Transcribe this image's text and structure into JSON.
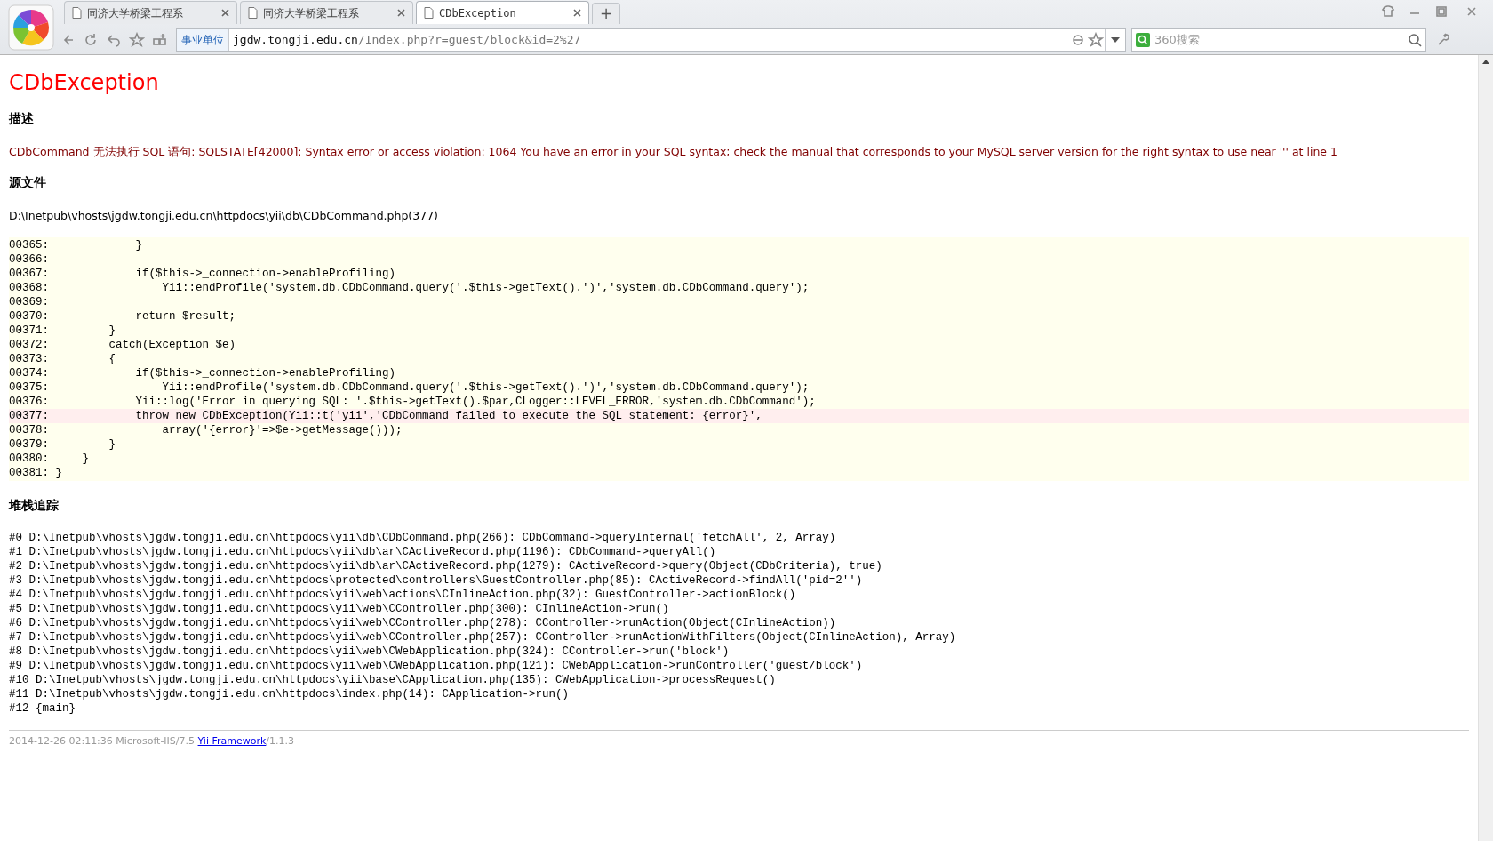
{
  "browser": {
    "tabs": [
      {
        "title": "同济大学桥梁工程系",
        "selected": false
      },
      {
        "title": "同济大学桥梁工程系",
        "selected": false
      },
      {
        "title": "CDbException",
        "selected": true
      }
    ],
    "new_tab": "+",
    "address_badge": "事业单位",
    "url_host": "jgdw.tongji.edu.cn",
    "url_path": "/Index.php?r=guest/block&id=2%27",
    "search_placeholder": "360搜索"
  },
  "page": {
    "title": "CDbException",
    "description_heading": "描述",
    "description": "CDbCommand 无法执行 SQL 语句: SQLSTATE[42000]: Syntax error or access violation: 1064 You have an error in your SQL syntax; check the manual that corresponds to your MySQL server version for the right syntax to use near ''' at line 1",
    "source_heading": "源文件",
    "source_file": "D:\\Inetpub\\vhosts\\jgdw.tongji.edu.cn\\httpdocs\\yii\\db\\CDbCommand.php(377)",
    "code_lines": [
      {
        "number": "00365:",
        "code": "            }",
        "highlighted": false
      },
      {
        "number": "00366:",
        "highlighted": false
      },
      {
        "number": "00367:",
        "code": "            if($this->_connection->enableProfiling)",
        "highlighted": false
      },
      {
        "number": "00368:",
        "code": "                Yii::endProfile('system.db.CDbCommand.query('.$this->getText().')','system.db.CDbCommand.query');",
        "highlighted": false
      },
      {
        "number": "00369:",
        "highlighted": false
      },
      {
        "number": "00370:",
        "code": "            return $result;",
        "highlighted": false
      },
      {
        "number": "00371:",
        "code": "        }",
        "highlighted": false
      },
      {
        "number": "00372:",
        "code": "        catch(Exception $e)",
        "highlighted": false
      },
      {
        "number": "00373:",
        "code": "        {",
        "highlighted": false
      },
      {
        "number": "00374:",
        "code": "            if($this->_connection->enableProfiling)",
        "highlighted": false
      },
      {
        "number": "00375:",
        "code": "                Yii::endProfile('system.db.CDbCommand.query('.$this->getText().')','system.db.CDbCommand.query');",
        "highlighted": false
      },
      {
        "number": "00376:",
        "code": "            Yii::log('Error in querying SQL: '.$this->getText().$par,CLogger::LEVEL_ERROR,'system.db.CDbCommand');",
        "highlighted": false
      },
      {
        "number": "00377:",
        "code": "            throw new CDbException(Yii::t('yii','CDbCommand failed to execute the SQL statement: {error}',",
        "highlighted": true
      },
      {
        "number": "00378:",
        "code": "                array('{error}'=>$e->getMessage()));",
        "highlighted": false
      },
      {
        "number": "00379:",
        "code": "        }",
        "highlighted": false
      },
      {
        "number": "00380:",
        "code": "    }",
        "highlighted": false
      },
      {
        "number": "00381:",
        "code": "}",
        "highlighted": false
      }
    ],
    "stack_heading": "堆栈追踪",
    "stack_trace": [
      "#0 D:\\Inetpub\\vhosts\\jgdw.tongji.edu.cn\\httpdocs\\yii\\db\\CDbCommand.php(266): CDbCommand->queryInternal('fetchAll', 2, Array)",
      "#1 D:\\Inetpub\\vhosts\\jgdw.tongji.edu.cn\\httpdocs\\yii\\db\\ar\\CActiveRecord.php(1196): CDbCommand->queryAll()",
      "#2 D:\\Inetpub\\vhosts\\jgdw.tongji.edu.cn\\httpdocs\\yii\\db\\ar\\CActiveRecord.php(1279): CActiveRecord->query(Object(CDbCriteria), true)",
      "#3 D:\\Inetpub\\vhosts\\jgdw.tongji.edu.cn\\httpdocs\\protected\\controllers\\GuestController.php(85): CActiveRecord->findAll('pid=2'')",
      "#4 D:\\Inetpub\\vhosts\\jgdw.tongji.edu.cn\\httpdocs\\yii\\web\\actions\\CInlineAction.php(32): GuestController->actionBlock()",
      "#5 D:\\Inetpub\\vhosts\\jgdw.tongji.edu.cn\\httpdocs\\yii\\web\\CController.php(300): CInlineAction->run()",
      "#6 D:\\Inetpub\\vhosts\\jgdw.tongji.edu.cn\\httpdocs\\yii\\web\\CController.php(278): CController->runAction(Object(CInlineAction))",
      "#7 D:\\Inetpub\\vhosts\\jgdw.tongji.edu.cn\\httpdocs\\yii\\web\\CController.php(257): CController->runActionWithFilters(Object(CInlineAction), Array)",
      "#8 D:\\Inetpub\\vhosts\\jgdw.tongji.edu.cn\\httpdocs\\yii\\web\\CWebApplication.php(324): CController->run('block')",
      "#9 D:\\Inetpub\\vhosts\\jgdw.tongji.edu.cn\\httpdocs\\yii\\web\\CWebApplication.php(121): CWebApplication->runController('guest/block')",
      "#10 D:\\Inetpub\\vhosts\\jgdw.tongji.edu.cn\\httpdocs\\yii\\base\\CApplication.php(135): CWebApplication->processRequest()",
      "#11 D:\\Inetpub\\vhosts\\jgdw.tongji.edu.cn\\httpdocs\\index.php(14): CApplication->run()",
      "#12 {main}"
    ],
    "footer": {
      "timestamp": "2014-12-26 02:11:36 Microsoft-IIS/7.5",
      "link": "Yii Framework",
      "version": "/1.1.3"
    }
  }
}
